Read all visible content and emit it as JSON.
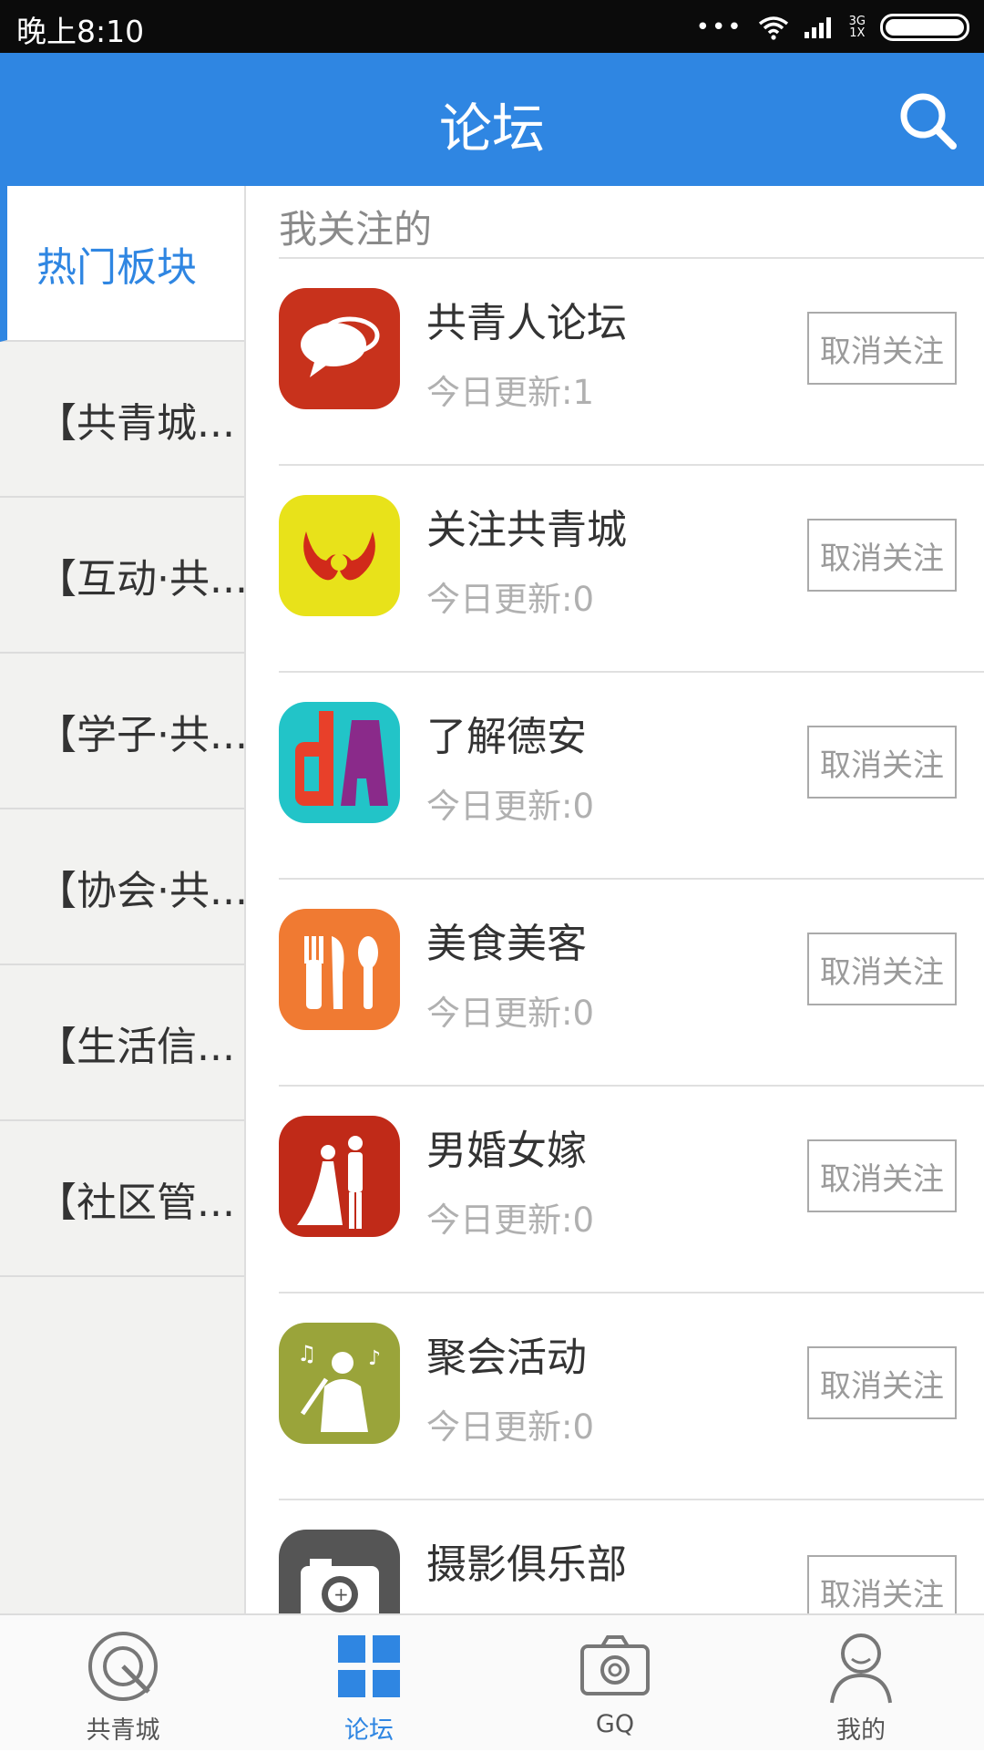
{
  "status_bar": {
    "time": "晚上8:10",
    "dots": "•••",
    "network_top": "3G",
    "network_bottom": "1X"
  },
  "header": {
    "title": "论坛"
  },
  "sidebar": {
    "items": [
      {
        "label": "热门板块"
      },
      {
        "label": "【共青城..."
      },
      {
        "label": "【互动·共..."
      },
      {
        "label": "【学子·共..."
      },
      {
        "label": "【协会·共..."
      },
      {
        "label": "【生活信..."
      },
      {
        "label": "【社区管..."
      }
    ]
  },
  "content": {
    "section_title": "我关注的",
    "boards": [
      {
        "name": "共青人论坛",
        "update": "今日更新:1",
        "button": "取消关注",
        "icon": "chat-bubbles-icon",
        "color": "#c8321c"
      },
      {
        "name": "关注共青城",
        "update": "今日更新:0",
        "button": "取消关注",
        "icon": "emblem-icon",
        "color": "#e8e21a"
      },
      {
        "name": "了解德安",
        "update": "今日更新:0",
        "button": "取消关注",
        "icon": "da-logo-icon",
        "color": "#22c4c8"
      },
      {
        "name": "美食美客",
        "update": "今日更新:0",
        "button": "取消关注",
        "icon": "cutlery-icon",
        "color": "#f07a32"
      },
      {
        "name": "男婚女嫁",
        "update": "今日更新:0",
        "button": "取消关注",
        "icon": "wedding-couple-icon",
        "color": "#c02a18"
      },
      {
        "name": "聚会活动",
        "update": "今日更新:0",
        "button": "取消关注",
        "icon": "singer-icon",
        "color": "#9aa43a"
      },
      {
        "name": "摄影俱乐部",
        "update": "",
        "button": "取消关注",
        "icon": "camera-icon",
        "color": "#555555"
      }
    ]
  },
  "tabbar": {
    "tabs": [
      {
        "label": "共青城",
        "icon": "home-target-icon"
      },
      {
        "label": "论坛",
        "icon": "grid-icon"
      },
      {
        "label": "GQ",
        "icon": "camera-icon"
      },
      {
        "label": "我的",
        "icon": "person-icon"
      }
    ]
  },
  "colors": {
    "accent": "#2f86e2",
    "status_bar": "#0b0b0b"
  }
}
